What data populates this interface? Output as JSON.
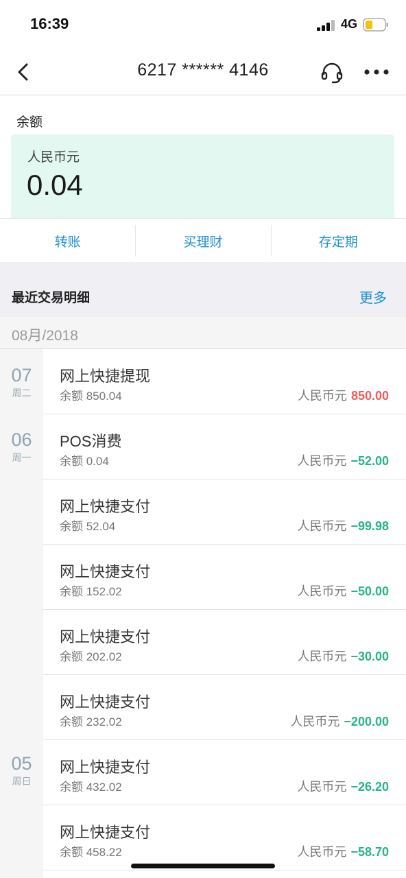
{
  "status": {
    "time": "16:39",
    "network": "4G"
  },
  "nav": {
    "title": "6217 ****** 4146"
  },
  "balance": {
    "label": "余额",
    "currency": "人民币元",
    "amount": "0.04"
  },
  "actions": [
    {
      "label": "转账"
    },
    {
      "label": "买理财"
    },
    {
      "label": "存定期"
    }
  ],
  "recent": {
    "title": "最近交易明细",
    "more": "更多"
  },
  "month": "08月/2018",
  "dates": [
    {
      "day": "07",
      "weekday": "周二"
    },
    {
      "day": "06",
      "weekday": "周一"
    },
    {
      "day": "05",
      "weekday": "周日"
    }
  ],
  "transactions": [
    {
      "title": "网上快捷提现",
      "balance": "余额 850.04",
      "currency": "人民币元",
      "amount": "850.00"
    },
    {
      "title": "POS消费",
      "balance": "余额 0.04",
      "currency": "人民币元",
      "amount": "−52.00"
    },
    {
      "title": "网上快捷支付",
      "balance": "余额 52.04",
      "currency": "人民币元",
      "amount": "−99.98"
    },
    {
      "title": "网上快捷支付",
      "balance": "余额 152.02",
      "currency": "人民币元",
      "amount": "−50.00"
    },
    {
      "title": "网上快捷支付",
      "balance": "余额 202.02",
      "currency": "人民币元",
      "amount": "−30.00"
    },
    {
      "title": "网上快捷支付",
      "balance": "余额 232.02",
      "currency": "人民币元",
      "amount": "−200.00"
    },
    {
      "title": "网上快捷支付",
      "balance": "余额 432.02",
      "currency": "人民币元",
      "amount": "−26.20"
    },
    {
      "title": "网上快捷支付",
      "balance": "余额 458.22",
      "currency": "人民币元",
      "amount": "−58.70"
    }
  ],
  "colors": {
    "accent": "#1c8fd6",
    "income": "#ee5c5c",
    "expense": "#26b48a",
    "card": "#e4f8f2"
  },
  "icons": {
    "back": "chevron-left-icon",
    "service": "headset-icon",
    "more": "more-dots-icon",
    "signal": "signal-icon",
    "battery": "battery-icon"
  }
}
